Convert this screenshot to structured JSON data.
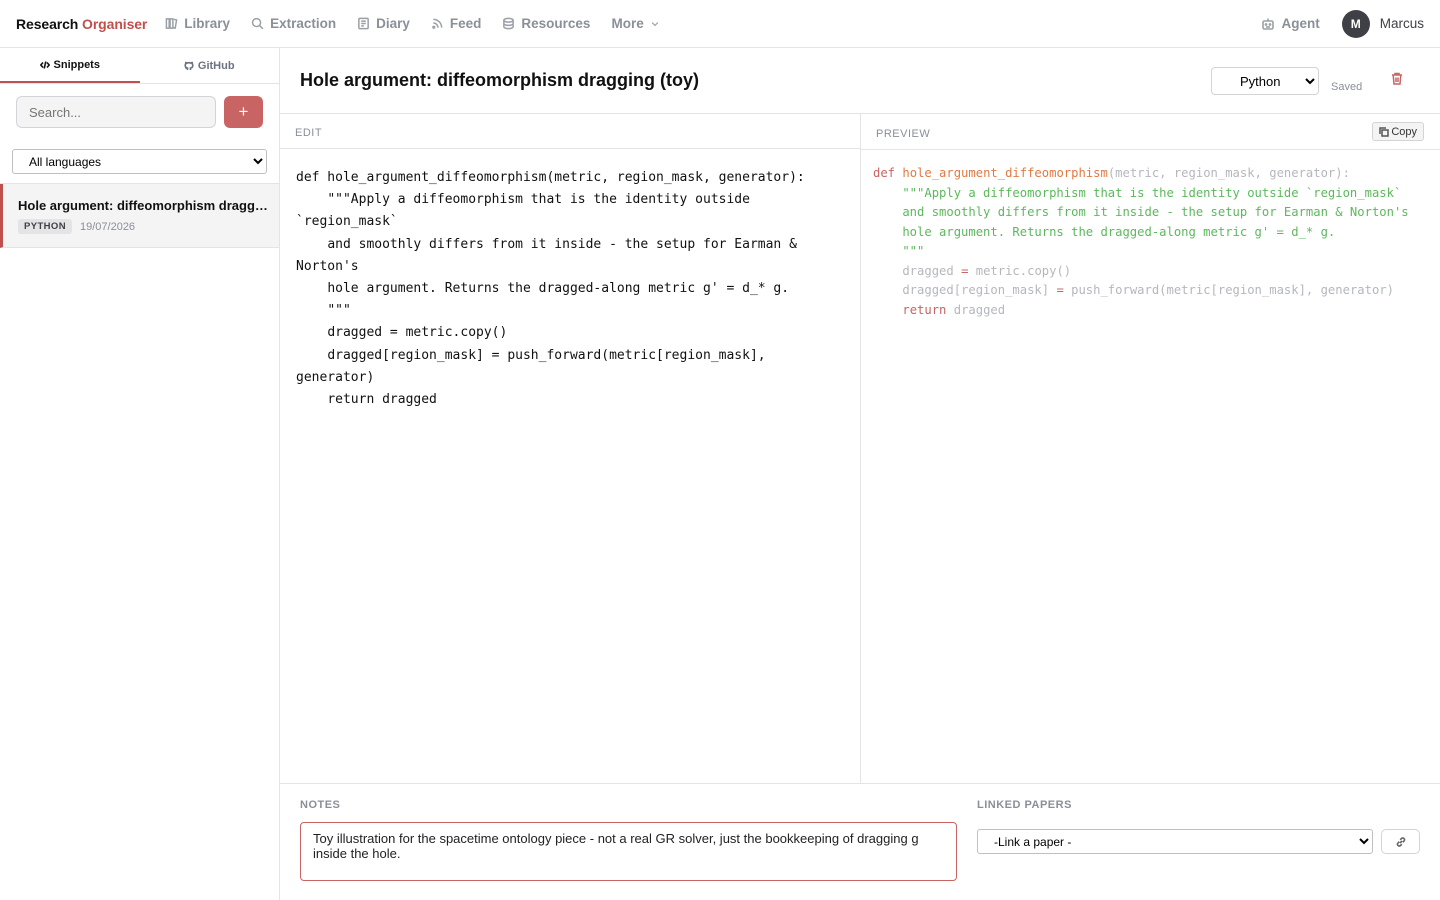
{
  "app": {
    "brand_prefix": "Research",
    "brand_accent": "Organiser",
    "accent_color": "#c0504d"
  },
  "nav": {
    "items": [
      {
        "label": "Library",
        "icon": "library-icon"
      },
      {
        "label": "Extraction",
        "icon": "search-icon"
      },
      {
        "label": "Diary",
        "icon": "notebook-icon"
      },
      {
        "label": "Feed",
        "icon": "rss-icon"
      },
      {
        "label": "Resources",
        "icon": "database-icon"
      }
    ],
    "more_label": "More",
    "agent_label": "Agent",
    "avatar_initial": "M",
    "username": "Marcus"
  },
  "sidebar": {
    "tabs": [
      {
        "label": "Snippets",
        "icon": "code-icon",
        "active": true
      },
      {
        "label": "GitHub",
        "icon": "github-icon",
        "active": false
      }
    ],
    "search_placeholder": "Search...",
    "add_label": "+",
    "language_filter": "All languages",
    "snippets": [
      {
        "title": "Hole argument: diffeomorphism dragging (toy)",
        "language": "PYTHON",
        "date": "19/07/2026"
      }
    ]
  },
  "editor": {
    "title": "Hole argument: diffeomorphism dragging (toy)",
    "language": "Python",
    "status": "Saved",
    "edit_label": "EDIT",
    "preview_label": "PREVIEW",
    "copy_label": "Copy",
    "code": "def hole_argument_diffeomorphism(metric, region_mask, generator):\n    \"\"\"Apply a diffeomorphism that is the identity outside `region_mask`\n    and smoothly differs from it inside - the setup for Earman & Norton's\n    hole argument. Returns the dragged-along metric g' = d_* g.\n    \"\"\"\n    dragged = metric.copy()\n    dragged[region_mask] = push_forward(metric[region_mask], generator)\n    return dragged"
  },
  "notes": {
    "label": "NOTES",
    "text": "Toy illustration for the spacetime ontology piece - not a real GR solver, just the bookkeeping of dragging g inside the hole."
  },
  "linked_papers": {
    "label": "LINKED PAPERS",
    "select_placeholder": "-Link a paper -"
  }
}
